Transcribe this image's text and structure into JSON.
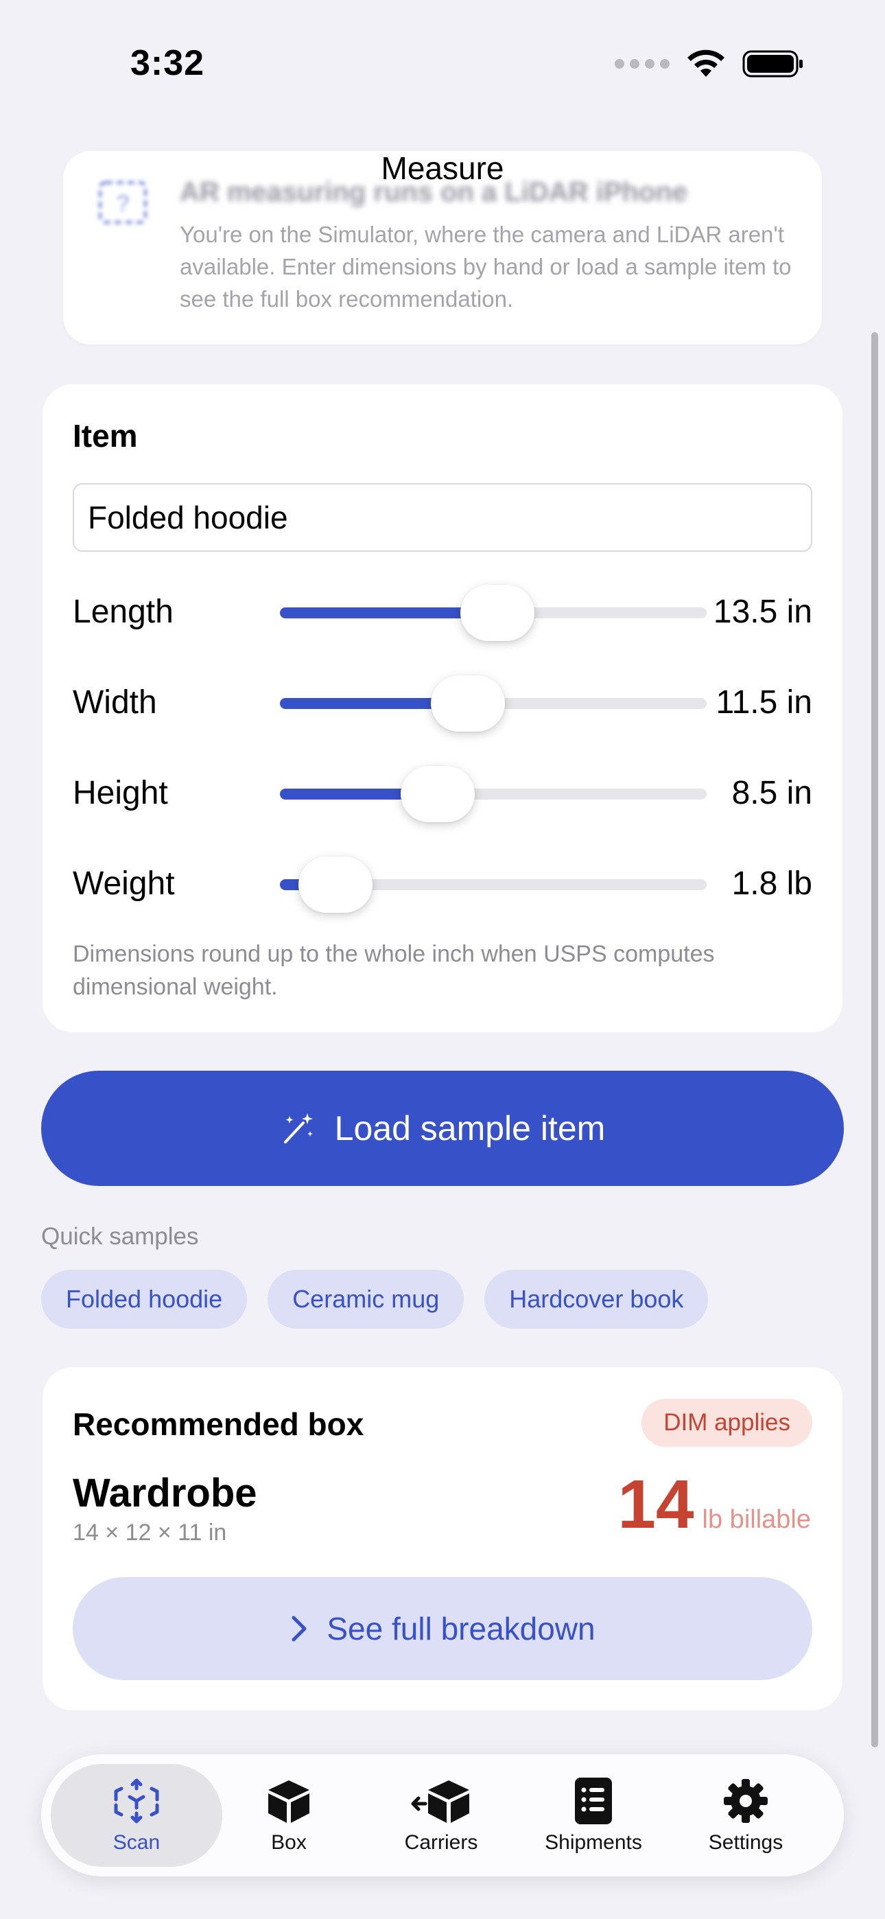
{
  "status_bar": {
    "time": "3:32"
  },
  "nav": {
    "title": "Measure"
  },
  "banner": {
    "title": "AR measuring runs on a LiDAR iPhone",
    "body": "You're on the Simulator, where the camera and LiDAR aren't available. Enter dimensions by hand or load a sample item to see the full box recommendation."
  },
  "item_card": {
    "heading": "Item",
    "name_value": "Folded hoodie",
    "sliders": [
      {
        "label": "Length",
        "value": "13.5 in",
        "fraction": 0.51
      },
      {
        "label": "Width",
        "value": "11.5 in",
        "fraction": 0.44
      },
      {
        "label": "Height",
        "value": "8.5 in",
        "fraction": 0.37
      },
      {
        "label": "Weight",
        "value": "1.8 lb",
        "fraction": 0.13
      }
    ],
    "note": "Dimensions round up to the whole inch when USPS computes dimensional weight."
  },
  "load_sample": {
    "label": "Load sample item",
    "icon": "magic-wand-icon"
  },
  "quick_samples": {
    "caption": "Quick samples",
    "chips": [
      "Folded hoodie",
      "Ceramic mug",
      "Hardcover book"
    ]
  },
  "recommended": {
    "heading": "Recommended box",
    "badge": "DIM applies",
    "box_name": "Wardrobe",
    "box_dims": "14 × 12 × 11 in",
    "billable_weight": "14",
    "billable_unit": "lb billable",
    "breakdown_label": "See full breakdown"
  },
  "tabs": [
    {
      "label": "Scan",
      "icon": "scan-icon",
      "active": true
    },
    {
      "label": "Box",
      "icon": "box-icon",
      "active": false
    },
    {
      "label": "Carriers",
      "icon": "carriers-icon",
      "active": false
    },
    {
      "label": "Shipments",
      "icon": "shipments-icon",
      "active": false
    },
    {
      "label": "Settings",
      "icon": "gear-icon",
      "active": false
    }
  ],
  "colors": {
    "accent": "#3751c8",
    "accent_soft": "#dcdff5",
    "warning": "#c74331",
    "warning_soft": "#fbe3df",
    "background": "#f2f1f7"
  }
}
